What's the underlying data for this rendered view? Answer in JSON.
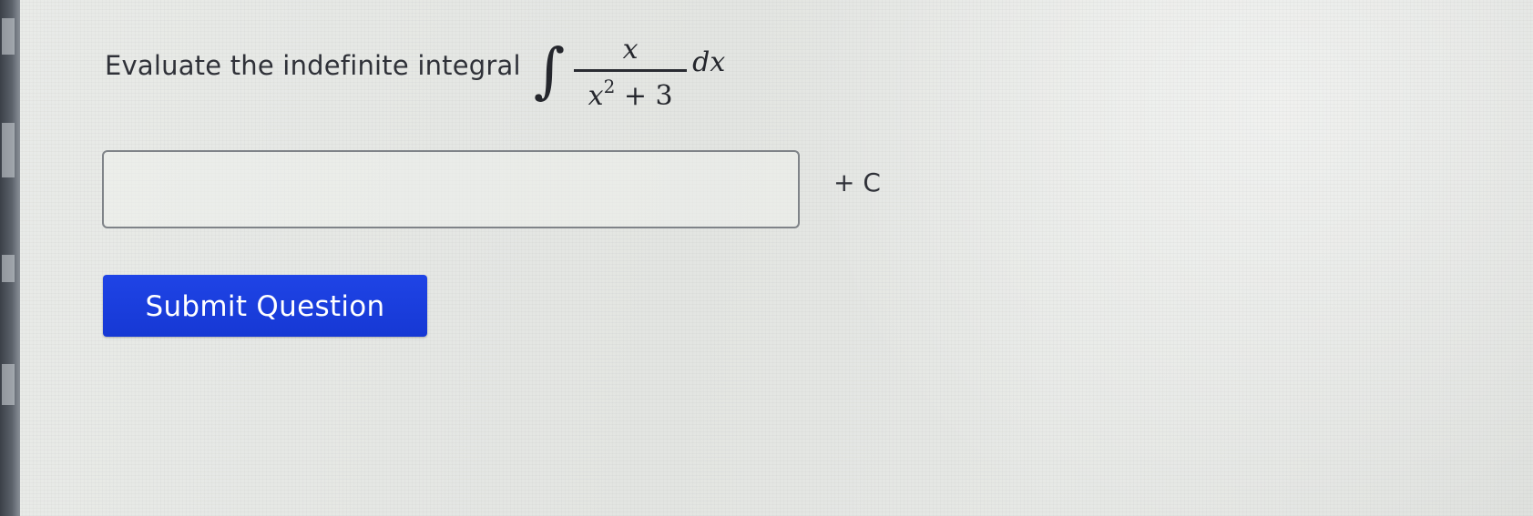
{
  "question": {
    "prompt": "Evaluate the indefinite integral",
    "integral_sign": "∫",
    "numerator": "x",
    "denominator_var": "x",
    "denominator_exp": "2",
    "denominator_rest": " + 3",
    "differential": "dx"
  },
  "answer": {
    "value": "",
    "placeholder": "",
    "suffix": "+ C"
  },
  "actions": {
    "submit_label": "Submit Question"
  },
  "colors": {
    "submit_button": "#1a3ce0",
    "page_background": "#e4e6e3",
    "text": "#2f3138"
  }
}
